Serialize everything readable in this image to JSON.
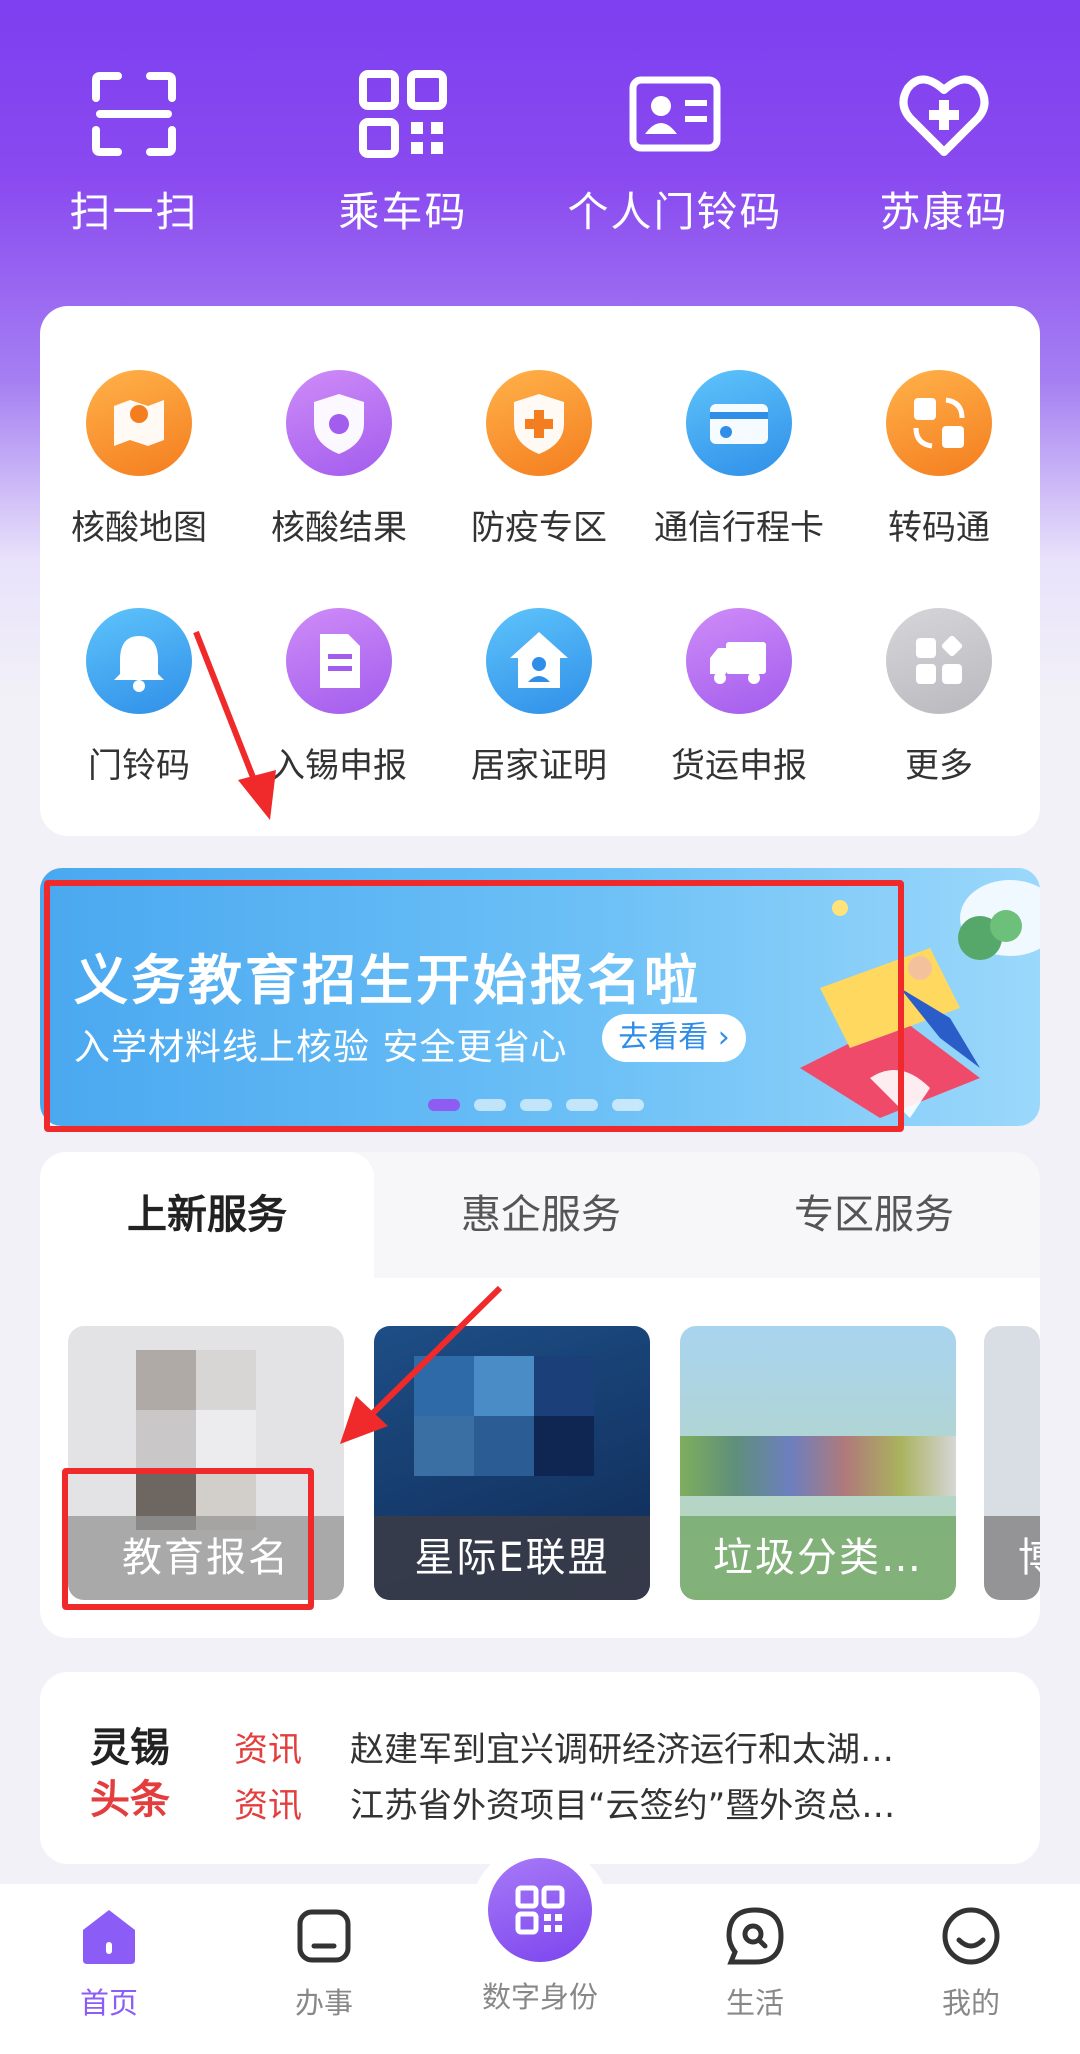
{
  "quick_actions": [
    {
      "label": "扫一扫",
      "icon": "scan-icon"
    },
    {
      "label": "乘车码",
      "icon": "qr-code-icon"
    },
    {
      "label": "个人门铃码",
      "icon": "id-card-icon"
    },
    {
      "label": "苏康码",
      "icon": "heart-plus-icon"
    }
  ],
  "services_row1": [
    {
      "label": "核酸地图",
      "icon": "map-icon",
      "color": "#f7962b"
    },
    {
      "label": "核酸结果",
      "icon": "virus-shield-icon",
      "color": "#b86ef2"
    },
    {
      "label": "防疫专区",
      "icon": "medical-shield-icon",
      "color": "#f7962b"
    },
    {
      "label": "通信行程卡",
      "icon": "card-icon",
      "color": "#3aa5f2"
    },
    {
      "label": "转码通",
      "icon": "convert-icon",
      "color": "#f7962b"
    }
  ],
  "services_row2": [
    {
      "label": "门铃码",
      "icon": "bell-icon",
      "color": "#3aa5f2"
    },
    {
      "label": "入锡申报",
      "icon": "document-icon",
      "color": "#b86ef2"
    },
    {
      "label": "居家证明",
      "icon": "home-icon",
      "color": "#3aa5f2"
    },
    {
      "label": "货运申报",
      "icon": "truck-icon",
      "color": "#b86ef2"
    },
    {
      "label": "更多",
      "icon": "more-grid-icon",
      "color": "#c8c8cc"
    }
  ],
  "banner": {
    "title": "义务教育招生开始报名啦",
    "subtitle": "入学材料线上核验 安全更省心",
    "button": "去看看",
    "slide_count": 5,
    "active_slide": 1
  },
  "tabs": [
    {
      "label": "上新服务",
      "active": true
    },
    {
      "label": "惠企服务",
      "active": false
    },
    {
      "label": "专区服务",
      "active": false
    }
  ],
  "tiles": [
    {
      "caption": "教育报名"
    },
    {
      "caption": "星际E联盟"
    },
    {
      "caption": "垃圾分类…"
    },
    {
      "caption": "博"
    }
  ],
  "news": {
    "brand_line1": "灵锡",
    "brand_line2": "头条",
    "items": [
      {
        "tag": "资讯",
        "text": "赵建军到宜兴调研经济运行和太湖…"
      },
      {
        "tag": "资讯",
        "text": "江苏省外资项目“云签约”暨外资总…"
      }
    ]
  },
  "bottom_nav": [
    {
      "label": "首页",
      "icon": "home-icon",
      "active": true
    },
    {
      "label": "办事",
      "icon": "task-icon",
      "active": false
    },
    {
      "label": "数字身份",
      "icon": "qr-code-icon",
      "active": false
    },
    {
      "label": "生活",
      "icon": "chat-search-icon",
      "active": false
    },
    {
      "label": "我的",
      "icon": "smile-icon",
      "active": false
    }
  ],
  "colors": {
    "purple": "#8b5cf6",
    "red_annotation": "#f02a2a",
    "news_tag": "#e33d3d"
  }
}
